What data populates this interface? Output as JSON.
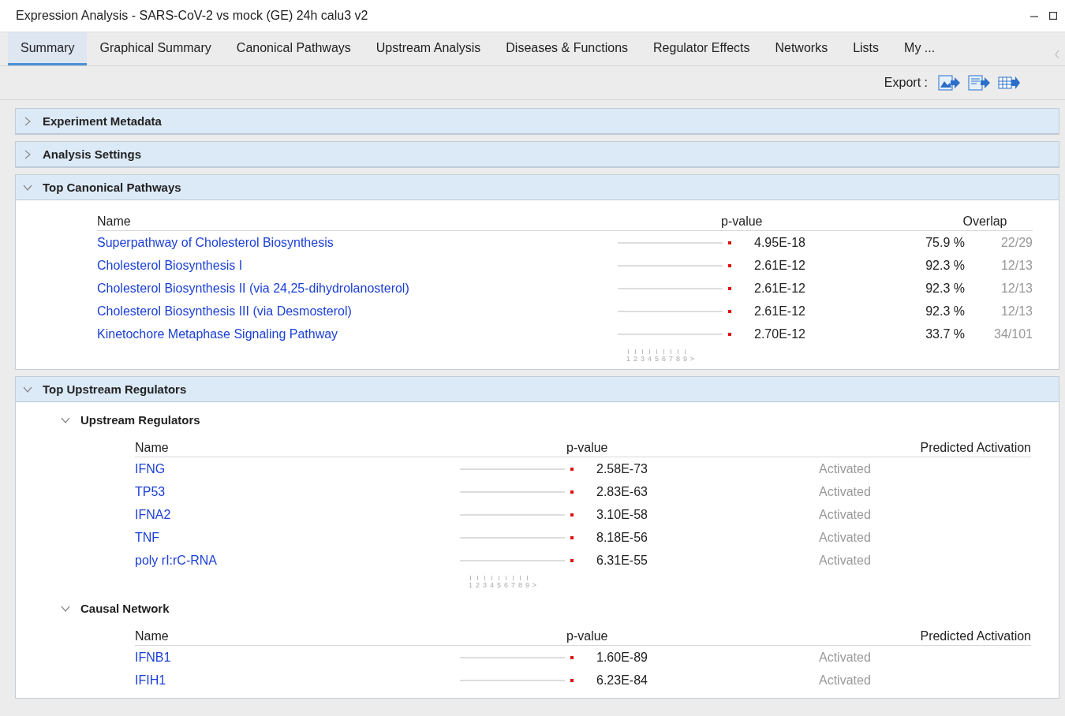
{
  "window": {
    "title": "Expression Analysis - SARS-CoV-2 vs mock (GE) 24h calu3 v2"
  },
  "tabs": [
    {
      "label": "Summary",
      "selected": true
    },
    {
      "label": "Graphical Summary",
      "selected": false
    },
    {
      "label": "Canonical Pathways",
      "selected": false
    },
    {
      "label": "Upstream Analysis",
      "selected": false
    },
    {
      "label": "Diseases & Functions",
      "selected": false
    },
    {
      "label": "Regulator Effects",
      "selected": false
    },
    {
      "label": "Networks",
      "selected": false
    },
    {
      "label": "Lists",
      "selected": false
    },
    {
      "label": "My ...",
      "selected": false
    }
  ],
  "toolbar": {
    "export_label": "Export :"
  },
  "sections": [
    {
      "title": "Experiment Metadata",
      "expanded": false
    },
    {
      "title": "Analysis Settings",
      "expanded": false
    },
    {
      "title": "Top Canonical Pathways",
      "expanded": true,
      "tables": [
        {
          "kind": "pathways",
          "columns": [
            "Name",
            "p-value",
            "Overlap"
          ],
          "scale": [
            "1",
            "2",
            "3",
            "4",
            "5",
            "6",
            "7",
            "8",
            "9",
            ">"
          ],
          "rows": [
            {
              "name": "Superpathway of Cholesterol Biosynthesis",
              "p_value": "4.95E-18",
              "overlap": "75.9 %",
              "ratio": "22/29"
            },
            {
              "name": "Cholesterol Biosynthesis I",
              "p_value": "2.61E-12",
              "overlap": "92.3 %",
              "ratio": "12/13"
            },
            {
              "name": "Cholesterol Biosynthesis II (via 24,25-dihydrolanosterol)",
              "p_value": "2.61E-12",
              "overlap": "92.3 %",
              "ratio": "12/13"
            },
            {
              "name": "Cholesterol Biosynthesis III (via Desmosterol)",
              "p_value": "2.61E-12",
              "overlap": "92.3 %",
              "ratio": "12/13"
            },
            {
              "name": "Kinetochore Metaphase Signaling Pathway",
              "p_value": "2.70E-12",
              "overlap": "33.7 %",
              "ratio": "34/101"
            }
          ]
        }
      ]
    },
    {
      "title": "Top Upstream Regulators",
      "expanded": true,
      "tables": [
        {
          "kind": "regulators",
          "title": "Upstream Regulators",
          "expanded": true,
          "columns": [
            "Name",
            "p-value",
            "Predicted Activation"
          ],
          "scale": [
            "1",
            "2",
            "3",
            "4",
            "5",
            "6",
            "7",
            "8",
            "9",
            ">"
          ],
          "rows": [
            {
              "name": "IFNG",
              "p_value": "2.58E-73",
              "activation": "Activated"
            },
            {
              "name": "TP53",
              "p_value": "2.83E-63",
              "activation": "Activated"
            },
            {
              "name": "IFNA2",
              "p_value": "3.10E-58",
              "activation": "Activated"
            },
            {
              "name": "TNF",
              "p_value": "8.18E-56",
              "activation": "Activated"
            },
            {
              "name": "poly rI:rC-RNA",
              "p_value": "6.31E-55",
              "activation": "Activated"
            }
          ]
        },
        {
          "kind": "regulators",
          "title": "Causal Network",
          "expanded": true,
          "columns": [
            "Name",
            "p-value",
            "Predicted Activation"
          ],
          "rows": [
            {
              "name": "IFNB1",
              "p_value": "1.60E-89",
              "activation": "Activated"
            },
            {
              "name": "IFIH1",
              "p_value": "6.23E-84",
              "activation": "Activated"
            }
          ]
        }
      ]
    }
  ]
}
